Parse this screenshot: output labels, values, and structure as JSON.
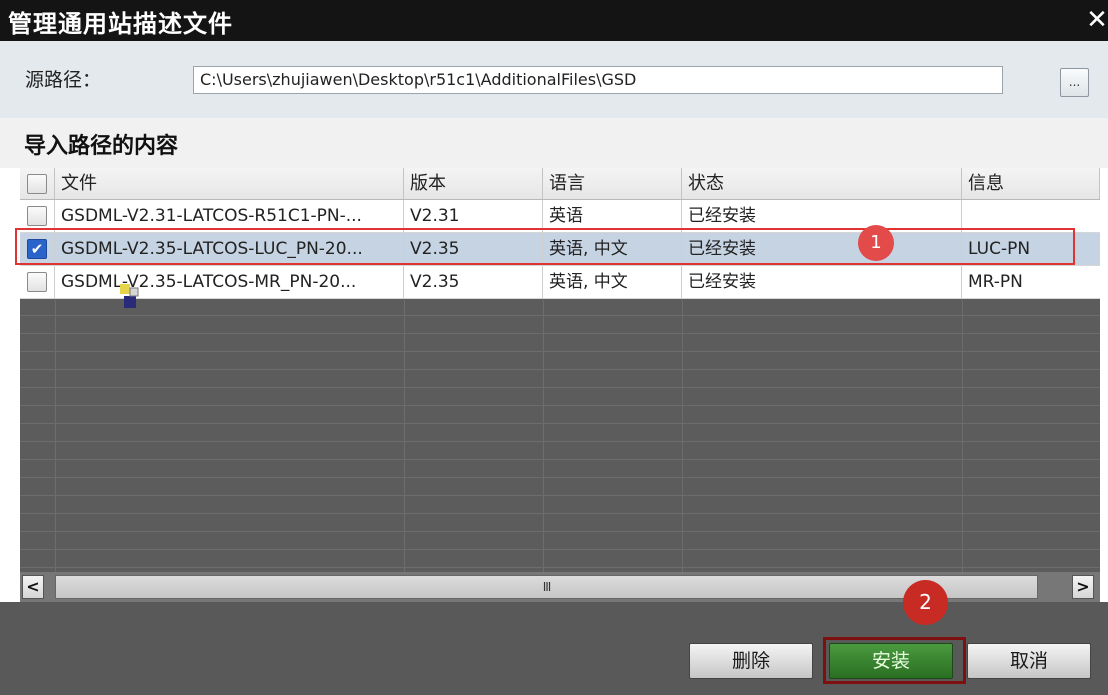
{
  "window": {
    "title": "管理通用站描述文件",
    "close_icon": "✕"
  },
  "source": {
    "label": "源路径：",
    "path": "C:\\Users\\zhujiawen\\Desktop\\r51c1\\AdditionalFiles\\GSD",
    "browse_label": "..."
  },
  "section": {
    "title": "导入路径的内容"
  },
  "table": {
    "columns": {
      "file": "文件",
      "version": "版本",
      "language": "语言",
      "status": "状态",
      "info": "信息"
    },
    "rows": [
      {
        "checked": false,
        "file": "GSDML-V2.31-LATCOS-R51C1-PN-...",
        "version": "V2.31",
        "language": "英语",
        "status": "已经安装",
        "info": ""
      },
      {
        "checked": true,
        "file": "GSDML-V2.35-LATCOS-LUC_PN-20...",
        "version": "V2.35",
        "language": "英语, 中文",
        "status": "已经安装",
        "info": "LUC-PN"
      },
      {
        "checked": false,
        "file": "GSDML-V2.35-LATCOS-MR_PN-20...",
        "version": "V2.35",
        "language": "英语, 中文",
        "status": "已经安装",
        "info": "MR-PN"
      }
    ]
  },
  "annotations": {
    "step1": "1",
    "step2": "2"
  },
  "scrollbar": {
    "left_icon": "<",
    "right_icon": ">",
    "grip": "III"
  },
  "buttons": {
    "delete": "删除",
    "install": "安装",
    "cancel": "取消"
  },
  "colors": {
    "title_bg": "#141414",
    "selection": "#c5d3e2",
    "highlight_red": "#e03333",
    "install_green": "#2a6f22"
  }
}
